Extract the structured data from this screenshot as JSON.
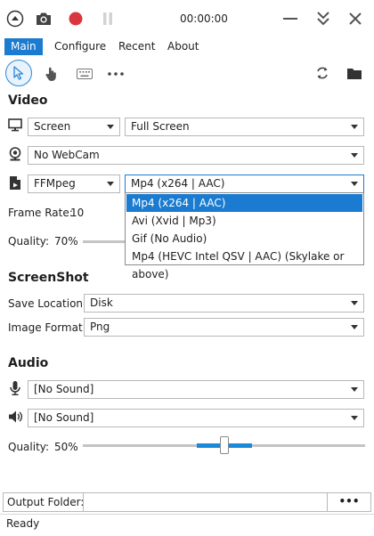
{
  "titlebar": {
    "timer": "00:00:00"
  },
  "tabs": [
    "Main",
    "Configure",
    "Recent",
    "About"
  ],
  "video": {
    "title": "Video",
    "source": "Screen",
    "source_detail": "Full Screen",
    "webcam": "No WebCam",
    "writer": "FFMpeg",
    "format": "Mp4 (x264 | AAC)",
    "frame_rate_label": "Frame Rate:",
    "frame_rate_value": "10",
    "quality_label": "Quality:",
    "quality_value": "70%",
    "quality_level": 0.7
  },
  "format_dropdown": {
    "options": [
      "Mp4 (x264 | AAC)",
      "Avi (Xvid | Mp3)",
      "Gif (No Audio)",
      "Mp4 (HEVC Intel QSV | AAC) (Skylake or above)"
    ],
    "selected": "Mp4 (x264 | AAC)"
  },
  "screenshot": {
    "title": "ScreenShot",
    "save_location_label": "Save Location:",
    "save_location_value": "Disk",
    "image_format_label": "Image Format:",
    "image_format_value": "Png"
  },
  "audio": {
    "title": "Audio",
    "microphone": "[No Sound]",
    "speaker": "[No Sound]",
    "quality_label": "Quality:",
    "quality_value": "50%",
    "quality_level": 0.5
  },
  "output": {
    "label": "Output Folder:",
    "value": "",
    "browse_label": "•••"
  },
  "status": {
    "text": "Ready"
  },
  "colors": {
    "accent": "#1a7bd0",
    "record": "#d9363e"
  }
}
